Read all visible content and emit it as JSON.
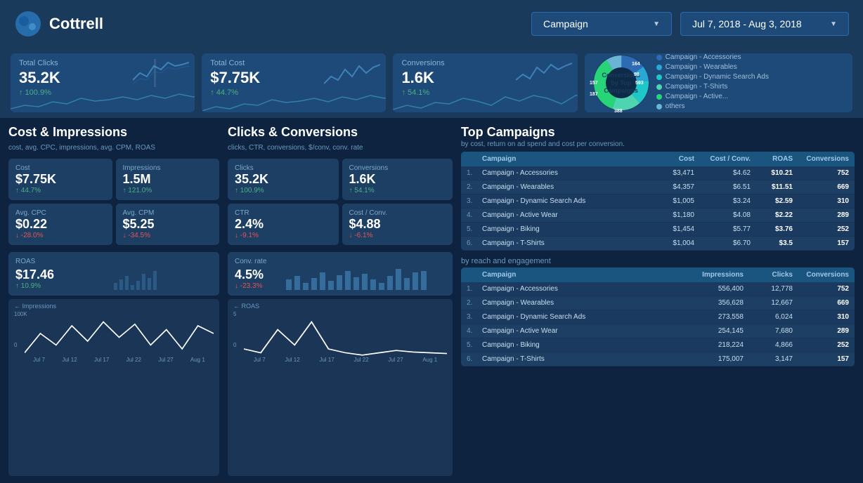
{
  "header": {
    "logo_text": "Cottrell",
    "campaign_dropdown": "Campaign",
    "date_range": "Jul 7, 2018 - Aug 3, 2018"
  },
  "metrics": {
    "total_clicks": {
      "label": "Total Clicks",
      "value": "35.2K",
      "change": "↑ 100.9%",
      "direction": "up"
    },
    "total_cost": {
      "label": "Total Cost",
      "value": "$7.75K",
      "change": "↑ 44.7%",
      "direction": "up"
    },
    "conversions": {
      "label": "Conversions",
      "value": "1.6K",
      "change": "↑ 54.1%",
      "direction": "up"
    }
  },
  "pie_chart": {
    "center_label": "Conversions by Top Campaigns",
    "total": "593",
    "segments": [
      {
        "label": "Campaign - Accessories",
        "value": 164,
        "color": "#2d6bb5"
      },
      {
        "label": "Campaign - Wearables",
        "value": 98,
        "color": "#2aa8d4"
      },
      {
        "label": "Campaign - Dynamic Search Ads",
        "value": 157,
        "color": "#1ec8c8"
      },
      {
        "label": "Campaign - T-Shirts",
        "value": 187,
        "color": "#28d478"
      },
      {
        "label": "Campaign - Active...",
        "value": 388,
        "color": "#4ed4b0"
      },
      {
        "label": "others",
        "value": 0,
        "color": "#6ab4d4"
      }
    ]
  },
  "cost_impressions": {
    "title": "Cost & Impressions",
    "subtitle": "cost, avg. CPC, impressions, avg. CPM, ROAS",
    "stats": [
      {
        "label": "Cost",
        "value": "$7.75K",
        "change": "↑ 44.7%",
        "direction": "up"
      },
      {
        "label": "Impressions",
        "value": "1.5M",
        "change": "↑ 121.0%",
        "direction": "up"
      },
      {
        "label": "Avg. CPC",
        "value": "$0.22",
        "change": "↓ -28.0%",
        "direction": "down"
      },
      {
        "label": "Avg. CPM",
        "value": "$5.25",
        "change": "↓ -34.5%",
        "direction": "down"
      },
      {
        "label": "ROAS",
        "value": "$17.46",
        "change": "↑ 10.9%",
        "direction": "up"
      }
    ],
    "chart_label": "← Impressions",
    "chart_y": "100K",
    "chart_x": [
      "Jul 7",
      "Jul 12",
      "Jul 17",
      "Jul 22",
      "Jul 27",
      "Aug 1"
    ]
  },
  "clicks_conversions": {
    "title": "Clicks & Conversions",
    "subtitle": "clicks, CTR, conversions, $/conv, conv. rate",
    "stats": [
      {
        "label": "Clicks",
        "value": "35.2K",
        "change": "↑ 100.9%",
        "direction": "up"
      },
      {
        "label": "Conversions",
        "value": "1.6K",
        "change": "↑ 54.1%",
        "direction": "up"
      },
      {
        "label": "CTR",
        "value": "2.4%",
        "change": "↓ -9.1%",
        "direction": "down"
      },
      {
        "label": "Cost / Conv.",
        "value": "$4.88",
        "change": "↓ -6.1%",
        "direction": "down"
      },
      {
        "label": "Conv. rate",
        "value": "4.5%",
        "change": "↓ -23.3%",
        "direction": "down"
      }
    ],
    "chart_label": "← ROAS",
    "chart_y": "5",
    "chart_x": [
      "Jul 7",
      "Jul 12",
      "Jul 17",
      "Jul 22",
      "Jul 27",
      "Aug 1"
    ]
  },
  "top_campaigns": {
    "title": "Top Campaigns",
    "subtitle": "by cost, return on ad spend  and cost per conversion.",
    "cost_table": {
      "headers": [
        "",
        "Campaign",
        "Cost",
        "Cost / Conv.",
        "ROAS",
        "Conversions"
      ],
      "rows": [
        {
          "num": "1.",
          "name": "Campaign - Accessories",
          "cost": "$3,471",
          "cost_conv": "$4.62",
          "roas": "$10.21",
          "conversions": "752"
        },
        {
          "num": "2.",
          "name": "Campaign - Wearables",
          "cost": "$4,357",
          "cost_conv": "$6.51",
          "roas": "$11.51",
          "conversions": "669"
        },
        {
          "num": "3.",
          "name": "Campaign - Dynamic Search Ads",
          "cost": "$1,005",
          "cost_conv": "$3.24",
          "roas": "$2.59",
          "conversions": "310"
        },
        {
          "num": "4.",
          "name": "Campaign - Active Wear",
          "cost": "$1,180",
          "cost_conv": "$4.08",
          "roas": "$2.22",
          "conversions": "289"
        },
        {
          "num": "5.",
          "name": "Campaign - Biking",
          "cost": "$1,454",
          "cost_conv": "$5.77",
          "roas": "$3.76",
          "conversions": "252"
        },
        {
          "num": "6.",
          "name": "Campaign - T-Shirts",
          "cost": "$1,004",
          "cost_conv": "$6.70",
          "roas": "$3.5",
          "conversions": "157"
        }
      ]
    },
    "engagement_label": "by reach and engagement",
    "engagement_table": {
      "headers": [
        "",
        "Campaign",
        "Impressions",
        "Clicks",
        "Conversions"
      ],
      "rows": [
        {
          "num": "1.",
          "name": "Campaign - Accessories",
          "impressions": "556,400",
          "clicks": "12,778",
          "conversions": "752"
        },
        {
          "num": "2.",
          "name": "Campaign - Wearables",
          "impressions": "356,628",
          "clicks": "12,667",
          "conversions": "669"
        },
        {
          "num": "3.",
          "name": "Campaign - Dynamic Search Ads",
          "impressions": "273,558",
          "clicks": "6,024",
          "conversions": "310"
        },
        {
          "num": "4.",
          "name": "Campaign - Active Wear",
          "impressions": "254,145",
          "clicks": "7,680",
          "conversions": "289"
        },
        {
          "num": "5.",
          "name": "Campaign - Biking",
          "impressions": "218,224",
          "clicks": "4,866",
          "conversions": "252"
        },
        {
          "num": "6.",
          "name": "Campaign - T-Shirts",
          "impressions": "175,007",
          "clicks": "3,147",
          "conversions": "157"
        }
      ]
    }
  }
}
